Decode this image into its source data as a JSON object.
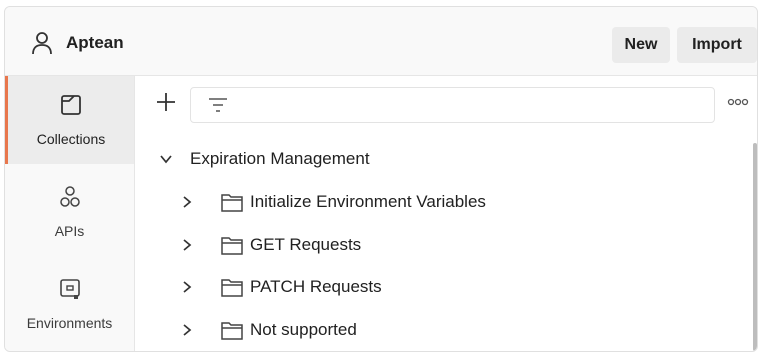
{
  "header": {
    "workspace_name": "Aptean",
    "new_label": "New",
    "import_label": "Import"
  },
  "sidebar": {
    "items": [
      {
        "label": "Collections",
        "icon": "collections-icon",
        "active": true
      },
      {
        "label": "APIs",
        "icon": "apis-icon",
        "active": false
      },
      {
        "label": "Environments",
        "icon": "environments-icon",
        "active": false
      }
    ]
  },
  "collections": {
    "root": {
      "label": "Expiration Management",
      "expanded": true
    },
    "folders": [
      {
        "label": "Initialize Environment Variables"
      },
      {
        "label": "GET Requests"
      },
      {
        "label": "PATCH Requests"
      },
      {
        "label": "Not supported"
      }
    ]
  },
  "colors": {
    "accent": "#e8774d",
    "active_bg": "#ececec"
  }
}
